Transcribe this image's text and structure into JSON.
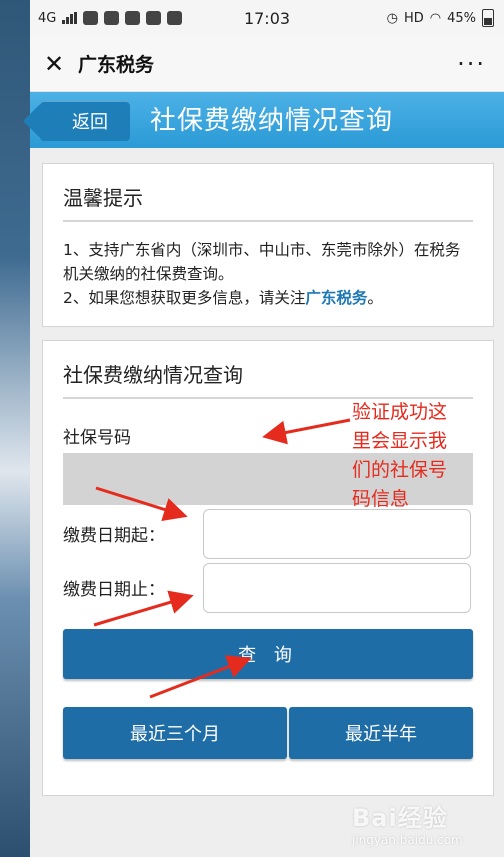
{
  "status_bar": {
    "network": "4G",
    "time": "17:03",
    "hd": "HD",
    "battery": "45%"
  },
  "title_bar": {
    "close_icon": "close-icon",
    "title": "广东税务",
    "more": "···"
  },
  "header": {
    "back_label": "返回",
    "title": "社保费缴纳情况查询"
  },
  "tips_card": {
    "heading": "温馨提示",
    "line1": "1、支持广东省内（深圳市、中山市、东莞市除外）在税务机关缴纳的社保费查询。",
    "line2_prefix": "2、如果您想获取更多信息，请关注",
    "line2_link": "广东税务",
    "line2_suffix": "。"
  },
  "query_card": {
    "heading": "社保费缴纳情况查询",
    "number_label": "社保号码",
    "date_start_label": "缴费日期起：",
    "date_end_label": "缴费日期止：",
    "query_button": "查 询",
    "last_3_months_button": "最近三个月",
    "last_half_year_button": "最近半年"
  },
  "annotation": {
    "text": "验证成功这里会显示我们的社保号码信息"
  },
  "watermark": {
    "text": "Bai经验",
    "sub": "jingyan.baidu.com"
  },
  "colors": {
    "header": "#2b9ad6",
    "button": "#1f6da7",
    "link": "#1d78b4",
    "annotation": "#e52b1e"
  }
}
